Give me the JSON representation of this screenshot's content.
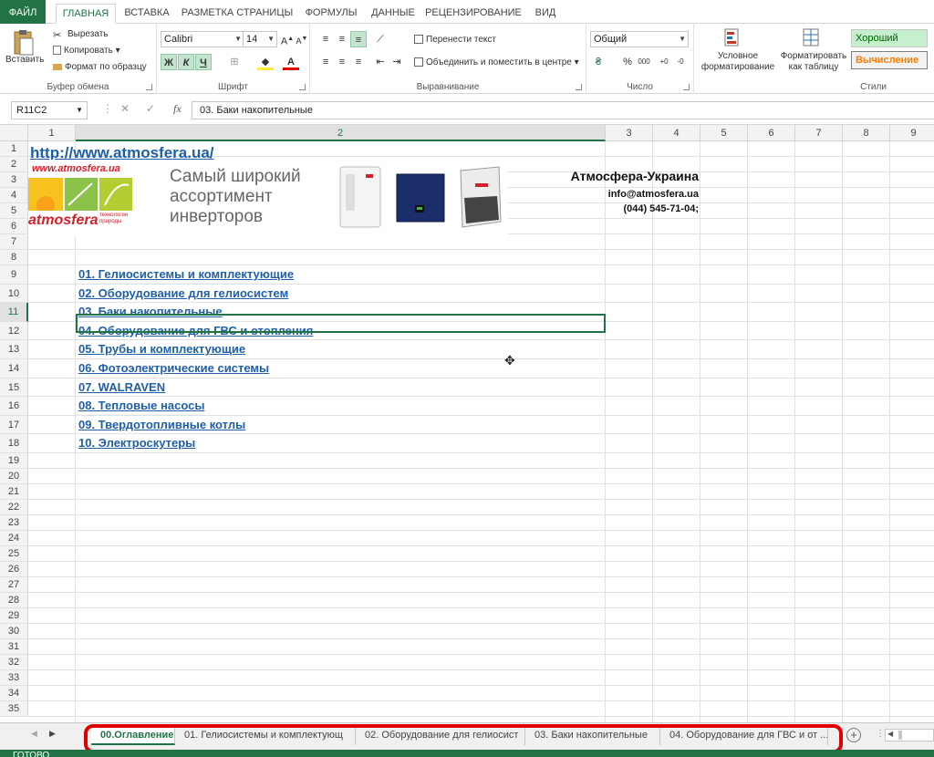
{
  "ribbon_tabs": [
    "ФАЙЛ",
    "ГЛАВНАЯ",
    "ВСТАВКА",
    "РАЗМЕТКА СТРАНИЦЫ",
    "ФОРМУЛЫ",
    "ДАННЫЕ",
    "РЕЦЕНЗИРОВАНИЕ",
    "ВИД"
  ],
  "clipboard": {
    "paste": "Вставить",
    "cut": "Вырезать",
    "copy": "Копировать",
    "format_painter": "Формат по образцу",
    "label": "Буфер обмена"
  },
  "font": {
    "name": "Calibri",
    "size": "14",
    "bold": "Ж",
    "italic": "К",
    "underline": "Ч",
    "label": "Шрифт"
  },
  "alignment": {
    "wrap": "Перенести текст",
    "merge": "Объединить и поместить в центре",
    "label": "Выравнивание"
  },
  "number": {
    "format": "Общий",
    "label": "Число"
  },
  "styles": {
    "conditional": "Условное форматирование",
    "table": "Форматировать как таблицу",
    "good": "Хороший",
    "calc": "Вычисление",
    "label": "Стили"
  },
  "formula_bar": {
    "name_box": "R11C2",
    "fx": "fx",
    "content": "03. Баки накопительные"
  },
  "columns": [
    "1",
    "2",
    "3",
    "4",
    "5",
    "6",
    "7",
    "8",
    "9"
  ],
  "rows": [
    "1",
    "2",
    "3",
    "4",
    "5",
    "6",
    "7",
    "8",
    "9",
    "10",
    "11",
    "12",
    "13",
    "14",
    "15",
    "16",
    "17",
    "18",
    "19",
    "20",
    "21",
    "22",
    "23",
    "24",
    "25",
    "26",
    "27",
    "28",
    "29",
    "30",
    "31",
    "32",
    "33",
    "34",
    "35"
  ],
  "url": "http://www.atmosfera.ua/",
  "banner": {
    "site": "www.atmosfera.ua",
    "brand": "atmosfera",
    "tagline": "технологии природы",
    "slogan1": "Самый широкий",
    "slogan2": "ассортимент",
    "slogan3": "инверторов"
  },
  "company": {
    "name": "Атмосфера-Украина",
    "email": "info@atmosfera.ua",
    "phone": "(044) 545-71-04;"
  },
  "links": [
    "01. Гелиосистемы и комплектующие",
    "02. Оборудование для гелиосистем",
    "03. Баки накопительные",
    "04. Оборудование для ГВС и отопления",
    "05. Трубы и комплектующие",
    "06. Фотоэлектрические системы",
    "07. WALRAVEN",
    "08. Тепловые насосы",
    "09. Твердотопливные котлы",
    "10. Электроскутеры"
  ],
  "sheet_tabs": [
    "00.Оглавление",
    "01. Гелиосистемы и комплектующ",
    "02. Оборудование для гелиосист",
    "03. Баки накопительные",
    "04. Оборудование для ГВС и от ..."
  ],
  "status": "ГОТОВО"
}
